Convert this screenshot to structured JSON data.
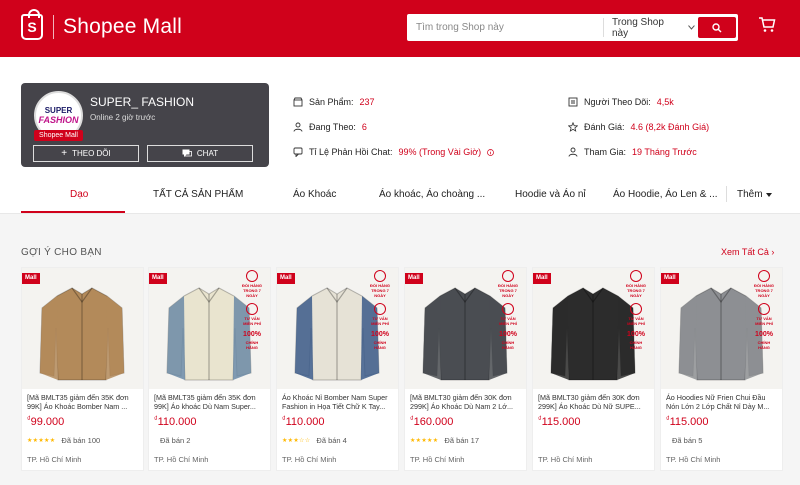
{
  "header": {
    "logo_text": "Shopee Mall",
    "logo_letter": "S",
    "search_placeholder": "Tìm trong Shop này",
    "search_scope": "Trong Shop này"
  },
  "shop": {
    "name": "SUPER_ FASHION",
    "status": "Online 2 giờ trước",
    "avatar_line1": "SUPER",
    "avatar_line2": "FASHION",
    "mall_badge": "Shopee Mall",
    "follow_label": "THEO DÕI",
    "chat_label": "CHAT",
    "stats": {
      "products_label": "Sản Phẩm:",
      "products_value": "237",
      "following_label": "Đang Theo:",
      "following_value": "6",
      "chat_label": "Tỉ Lệ Phản Hồi Chat:",
      "chat_value": "99% (Trong Vài Giờ)",
      "followers_label": "Người Theo Dõi:",
      "followers_value": "4,5k",
      "rating_label": "Đánh Giá:",
      "rating_value": "4.6 (8,2k Đánh Giá)",
      "joined_label": "Tham Gia:",
      "joined_value": "19 Tháng Trước"
    }
  },
  "tabs": [
    {
      "label": "Dạo"
    },
    {
      "label": "TẤT CẢ SẢN PHẨM"
    },
    {
      "label": "Áo Khoác"
    },
    {
      "label": "Áo khoác, Áo choàng ..."
    },
    {
      "label": "Hoodie và Áo nỉ"
    },
    {
      "label": "Áo Hoodie, Áo Len & ..."
    },
    {
      "label": "Thêm"
    }
  ],
  "recommendations": {
    "title": "GỢI Ý CHO BẠN",
    "see_all": "Xem Tất Cả"
  },
  "badge_texts": {
    "mall": "Mall",
    "exchange": "ĐỔI HÀNG TRONG 7 NGÀY",
    "consult": "TƯ VẤN MIỄN PHÍ",
    "genuine": "100%",
    "genuine_sub": "CHÍNH HÃNG"
  },
  "products": [
    {
      "name": "[Mã BMLT35 giảm đến 35K đơn 99K] Áo Khoác Bomber Nam ...",
      "currency": "₫",
      "price": "99.000",
      "stars": "★★★★★",
      "sold": "Đã bán 100",
      "location": "TP. Hồ Chí Minh",
      "color": "#b38a5a"
    },
    {
      "name": "[Mã BMLT35 giảm đến 35K đơn 99K] Áo khoác Dù Nam Super...",
      "currency": "₫",
      "price": "110.000",
      "stars": "",
      "sold": "Đã bán 2",
      "location": "TP. Hồ Chí Minh",
      "color": "#e9e4cf"
    },
    {
      "name": "Áo Khoác Nỉ Bomber Nam Super Fashion in Họa Tiết Chữ K Tay...",
      "currency": "₫",
      "price": "110.000",
      "stars": "★★★☆☆",
      "sold": "Đã bán 4",
      "location": "TP. Hồ Chí Minh",
      "color": "#e6e2d6"
    },
    {
      "name": "[Mã BMLT30 giảm đến 30K đơn 299K] Áo Khoác Dù Nam 2 Lớ...",
      "currency": "₫",
      "price": "160.000",
      "stars": "★★★★★",
      "sold": "Đã bán 17",
      "location": "TP. Hồ Chí Minh",
      "color": "#4a4d52"
    },
    {
      "name": "[Mã BMLT30 giảm đến 30K đơn 299K] Áo Khoác Dù Nữ SUPE...",
      "currency": "₫",
      "price": "115.000",
      "stars": "",
      "sold": "",
      "location": "TP. Hồ Chí Minh",
      "color": "#2c2c2c"
    },
    {
      "name": "Áo Hoodies Nữ Frien Chui Đầu Nón Lớn 2 Lớp Chất Nỉ Dày M...",
      "currency": "₫",
      "price": "115.000",
      "stars": "",
      "sold": "Đã bán 5",
      "location": "TP. Hồ Chí Minh",
      "color": "#8d8f93"
    }
  ]
}
